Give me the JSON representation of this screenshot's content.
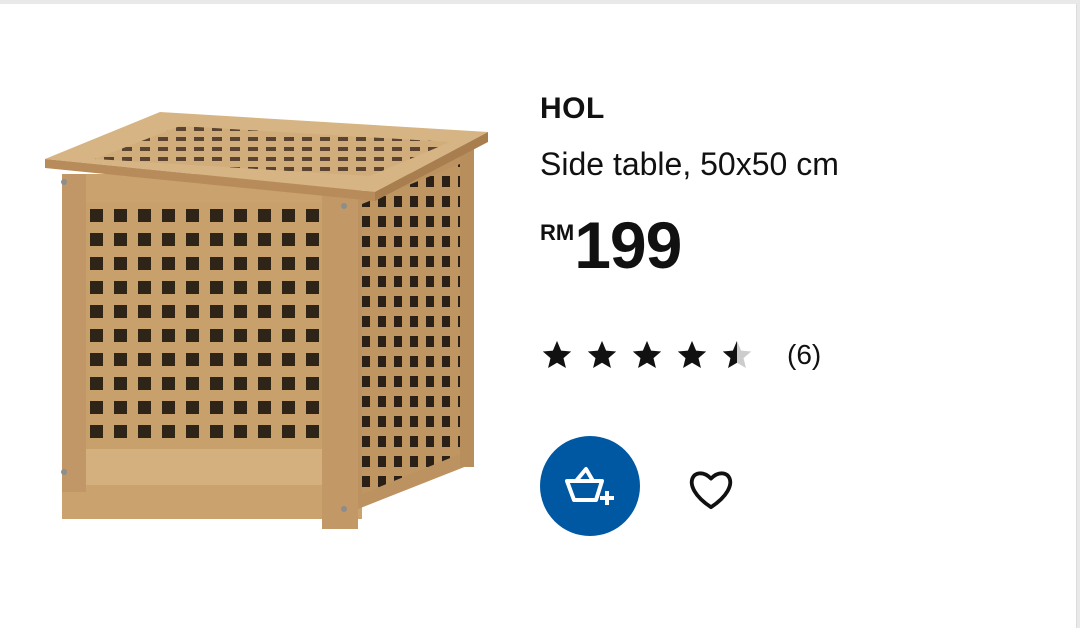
{
  "product": {
    "name": "HOL",
    "description": "Side table, 50x50 cm",
    "price_currency": "RM",
    "price_amount": "199",
    "rating": {
      "value": 4.5,
      "max": 5,
      "count_label": "(6)"
    }
  },
  "icons": {
    "cart": "add-to-cart-icon",
    "favourite": "heart-outline-icon",
    "star": "star-icon"
  },
  "colors": {
    "cart_button": "#0058a3",
    "text": "#111111",
    "star_empty": "#cccccc"
  }
}
